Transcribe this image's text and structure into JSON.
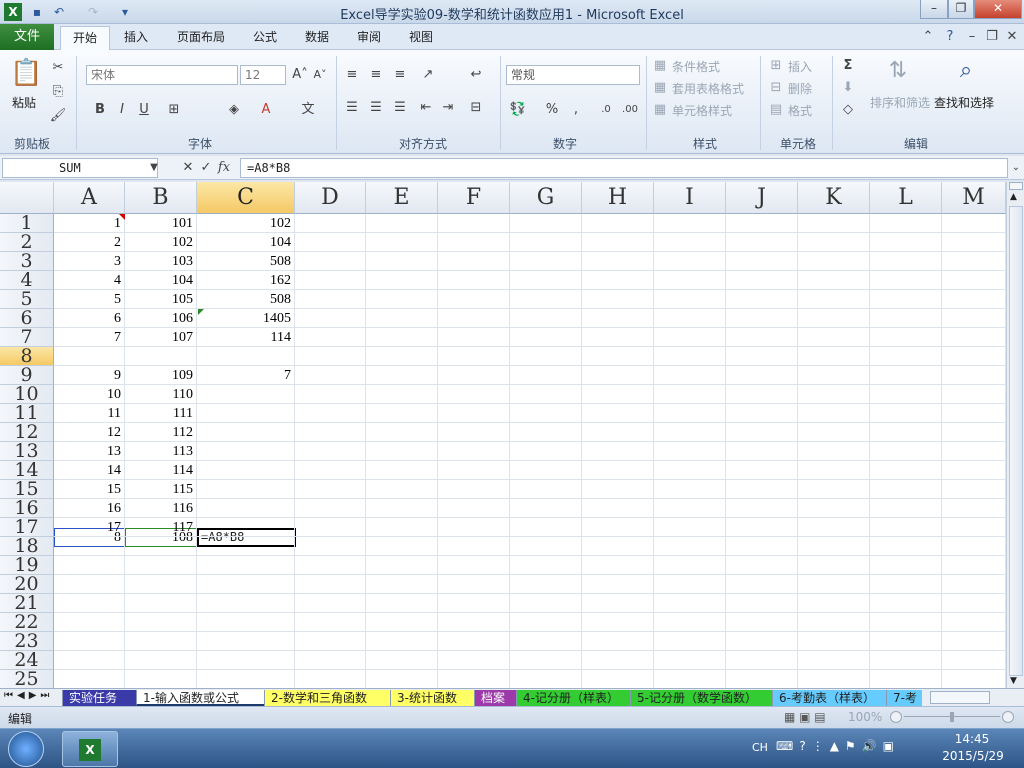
{
  "window": {
    "title": "Excel导学实验09-数学和统计函数应用1 - Microsoft Excel"
  },
  "ribbon_tabs": [
    "文件",
    "开始",
    "插入",
    "页面布局",
    "公式",
    "数据",
    "审阅",
    "视图"
  ],
  "ribbon": {
    "clipboard": {
      "paste": "粘贴",
      "group": "剪贴板"
    },
    "font": {
      "font_name": "宋体",
      "font_size": "12",
      "group": "字体",
      "bold": "B",
      "italic": "I",
      "underline": "U"
    },
    "alignment": {
      "group": "对齐方式"
    },
    "number": {
      "format": "常规",
      "percent": "%",
      "group": "数字"
    },
    "styles": {
      "conditional": "条件格式",
      "table": "套用表格格式",
      "cell": "单元格样式",
      "group": "样式"
    },
    "cells": {
      "insert": "插入",
      "delete": "删除",
      "format": "格式",
      "group": "单元格"
    },
    "editing": {
      "sigma": "Σ",
      "sort": "排序和筛选",
      "find": "查找和选择",
      "group": "编辑"
    }
  },
  "formula_bar": {
    "name_box": "SUM",
    "fx": "fx",
    "formula": "=A8*B8"
  },
  "columns": [
    "A",
    "B",
    "C",
    "D",
    "E",
    "F",
    "G",
    "H",
    "I",
    "J",
    "K",
    "L",
    "M"
  ],
  "rows": [
    "1",
    "2",
    "3",
    "4",
    "5",
    "6",
    "7",
    "8",
    "9",
    "10",
    "11",
    "12",
    "13",
    "14",
    "15",
    "16",
    "17",
    "18",
    "19",
    "20",
    "21",
    "22",
    "23",
    "24",
    "25"
  ],
  "cells": {
    "A": [
      "1",
      "2",
      "3",
      "4",
      "5",
      "6",
      "7",
      "8",
      "9",
      "10",
      "11",
      "12",
      "13",
      "14",
      "15",
      "16",
      "17"
    ],
    "B": [
      "101",
      "102",
      "103",
      "104",
      "105",
      "106",
      "107",
      "108",
      "109",
      "110",
      "111",
      "112",
      "113",
      "114",
      "115",
      "116",
      "117"
    ],
    "C": [
      "102",
      "104",
      "508",
      "162",
      "508",
      "1405",
      "114",
      "",
      "7"
    ]
  },
  "active_cell": {
    "ref": "C8",
    "editing_text": "=A8*B8"
  },
  "sheet_tabs": [
    {
      "label": "实验任务",
      "color": "#3a3aa8"
    },
    {
      "label": "1-输入函数或公式",
      "color": "#ffffff"
    },
    {
      "label": "2-数学和三角函数",
      "color": "#ffff66"
    },
    {
      "label": "3-统计函数",
      "color": "#ffff66"
    },
    {
      "label": "档案",
      "color": "#9b3aa8"
    },
    {
      "label": "4-记分册（样表）",
      "color": "#33cc33"
    },
    {
      "label": "5-记分册（数学函数）",
      "color": "#33cc33"
    },
    {
      "label": "6-考勤表（样表）",
      "color": "#66ccff"
    },
    {
      "label": "7-考",
      "color": "#66ccff"
    }
  ],
  "status": {
    "mode": "编辑",
    "zoom": "100%"
  },
  "taskbar": {
    "lang": "CH",
    "time": "14:45",
    "date": "2015/5/29"
  }
}
